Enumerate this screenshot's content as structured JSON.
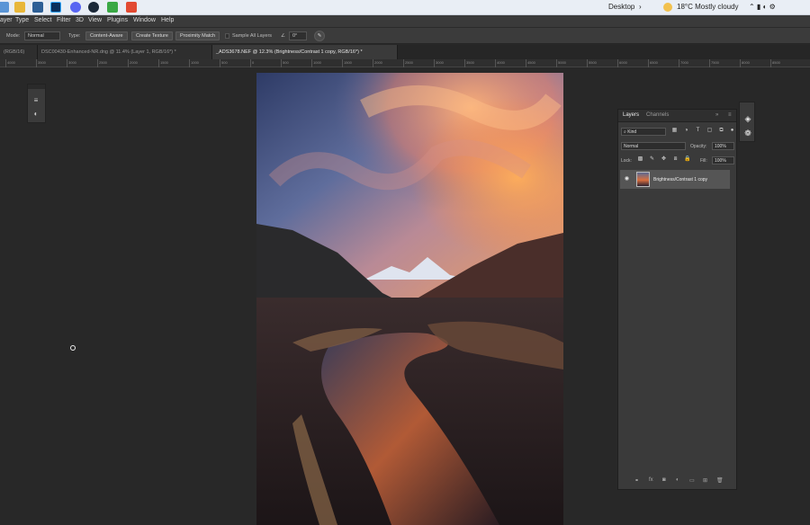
{
  "taskbar": {
    "desktop_label": "Desktop",
    "weather": "18°C  Mostly cloudy"
  },
  "menu": {
    "items": [
      "ayer",
      "Type",
      "Select",
      "Filter",
      "3D",
      "View",
      "Plugins",
      "Window",
      "Help"
    ]
  },
  "options": {
    "mode_label": "Mode:",
    "mode_value": "Normal",
    "type_label": "Type:",
    "btn_content_aware": "Content-Aware",
    "btn_create_texture": "Create Texture",
    "btn_proximity_match": "Proximity Match",
    "sample_all_layers": "Sample All Layers",
    "angle_value": "0°"
  },
  "tabs": [
    {
      "label": "(RGB/16)",
      "active": false
    },
    {
      "label": "DSC00430-Enhanced-NR.dng @ 11.4% (Layer 1, RGB/16*) *",
      "active": false
    },
    {
      "label": "_ADS3678.NEF @ 12.3% (Brightness/Contrast 1 copy, RGB/16*) *",
      "active": true
    }
  ],
  "ruler": {
    "ticks": [
      "4000",
      "3500",
      "3000",
      "2500",
      "2000",
      "1500",
      "1000",
      "500",
      "0",
      "500",
      "1000",
      "1500",
      "2000",
      "2500",
      "3000",
      "3500",
      "4000",
      "4500",
      "5000",
      "5500",
      "6000",
      "6500",
      "7000",
      "7500",
      "8000",
      "8500"
    ]
  },
  "layers_panel": {
    "tab_layers": "Layers",
    "tab_channels": "Channels",
    "filter_kind": "Kind",
    "blend_mode": "Normal",
    "opacity_label": "Opacity:",
    "opacity_value": "100%",
    "lock_label": "Lock:",
    "fill_label": "Fill:",
    "fill_value": "100%",
    "layers": [
      {
        "name": "Brightness/Contrast 1 copy",
        "visible": true
      }
    ]
  },
  "colors": {
    "accent_taskbar": "#e9eef5",
    "ps_panel": "#3a3a3a",
    "ps_canvas": "#282828"
  }
}
